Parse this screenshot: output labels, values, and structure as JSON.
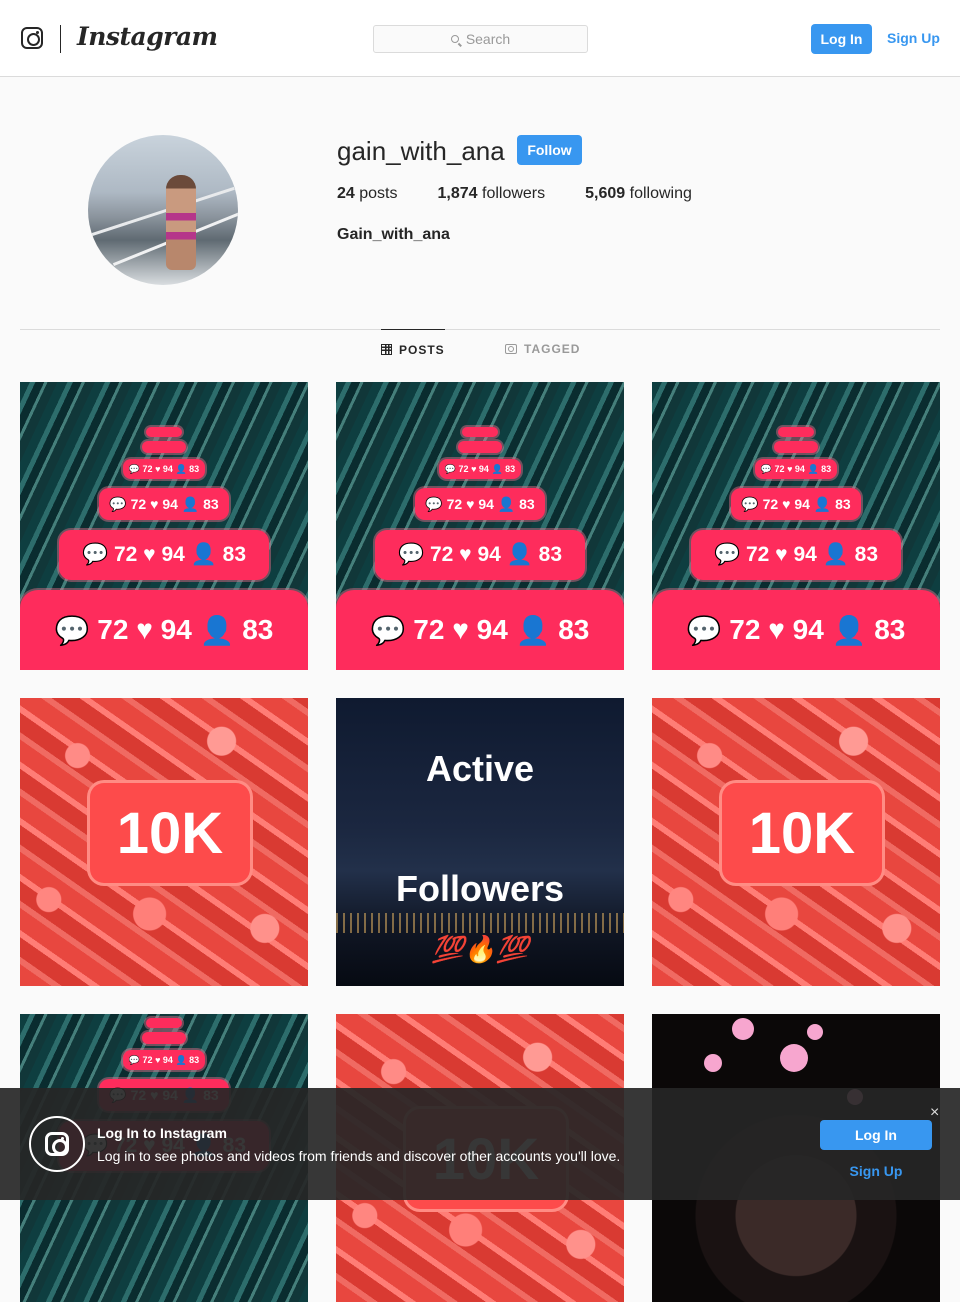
{
  "header": {
    "brand": "Instagram",
    "search_placeholder": "Search",
    "login_label": "Log In",
    "signup_label": "Sign Up"
  },
  "profile": {
    "username": "gain_with_ana",
    "follow_label": "Follow",
    "posts_count": "24",
    "posts_label": "posts",
    "followers_count": "1,874",
    "followers_label": "followers",
    "following_count": "5,609",
    "following_label": "following",
    "full_name": "Gain_with_ana"
  },
  "tabs": [
    {
      "label": "POSTS",
      "active": true
    },
    {
      "label": "TAGGED",
      "active": false
    }
  ],
  "posts": {
    "stat_comments": "72",
    "stat_likes": "94",
    "stat_followers": "83",
    "tenk_text": "10K",
    "active_title": "Active",
    "followers_title": "Followers",
    "emoji_line": "💯🔥💯"
  },
  "banner": {
    "title": "Log In to Instagram",
    "description": "Log in to see photos and videos from friends and discover other accounts you'll love.",
    "login_label": "Log In",
    "signup_label": "Sign Up",
    "close_glyph": "×"
  },
  "colors": {
    "accent": "#3897f0",
    "bubble": "#fe2c5c",
    "tenk": "#fd4b4b"
  }
}
